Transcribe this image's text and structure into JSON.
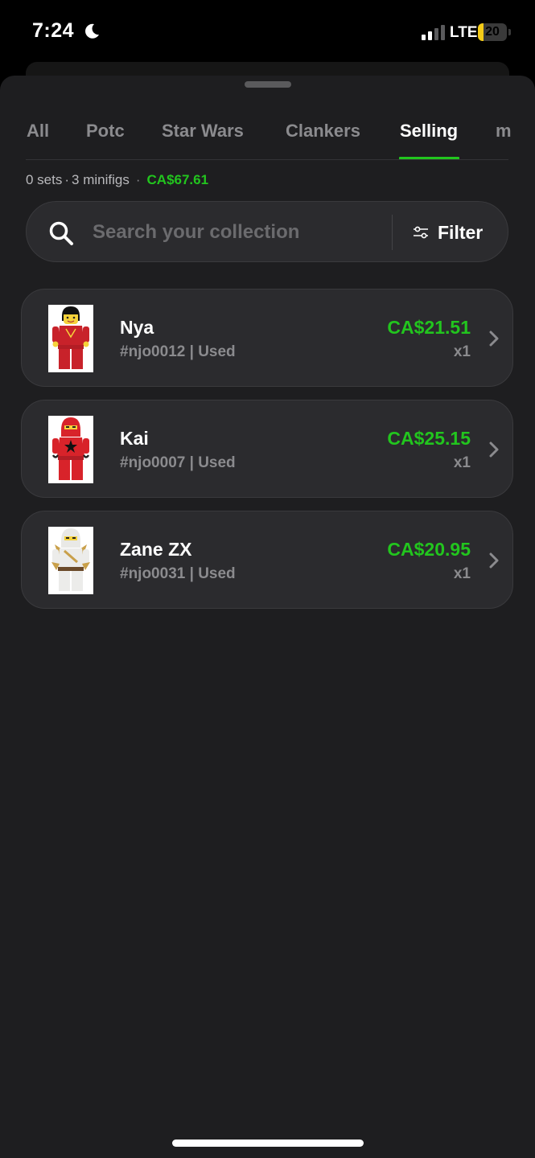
{
  "status": {
    "time": "7:24",
    "network": "LTE",
    "battery": "20",
    "battery_level": 0.2,
    "icons": [
      "moon-icon",
      "signal-icon",
      "battery-icon"
    ]
  },
  "tabs": [
    {
      "label": "All",
      "active": false
    },
    {
      "label": "Potc",
      "active": false
    },
    {
      "label": "Star Wars",
      "active": false
    },
    {
      "label": "Clankers",
      "active": false
    },
    {
      "label": "Selling",
      "active": true
    },
    {
      "label": "m",
      "active": false
    }
  ],
  "summary": {
    "sets": "0 sets",
    "minifigs": "3 minifigs",
    "separator": "·",
    "total": "CA$67.61"
  },
  "search": {
    "placeholder": "Search your collection",
    "filter_label": "Filter"
  },
  "items": [
    {
      "name": "Nya",
      "sub": "#njo0012 | Used",
      "price": "CA$21.51",
      "qty": "x1"
    },
    {
      "name": "Kai",
      "sub": "#njo0007 | Used",
      "price": "CA$25.15",
      "qty": "x1"
    },
    {
      "name": "Zane ZX",
      "sub": "#njo0031 | Used",
      "price": "CA$20.95",
      "qty": "x1"
    }
  ],
  "colors": {
    "accent": "#22c51e",
    "background": "#1e1e20",
    "card": "#2b2b2e",
    "muted": "#8b8b8e"
  }
}
